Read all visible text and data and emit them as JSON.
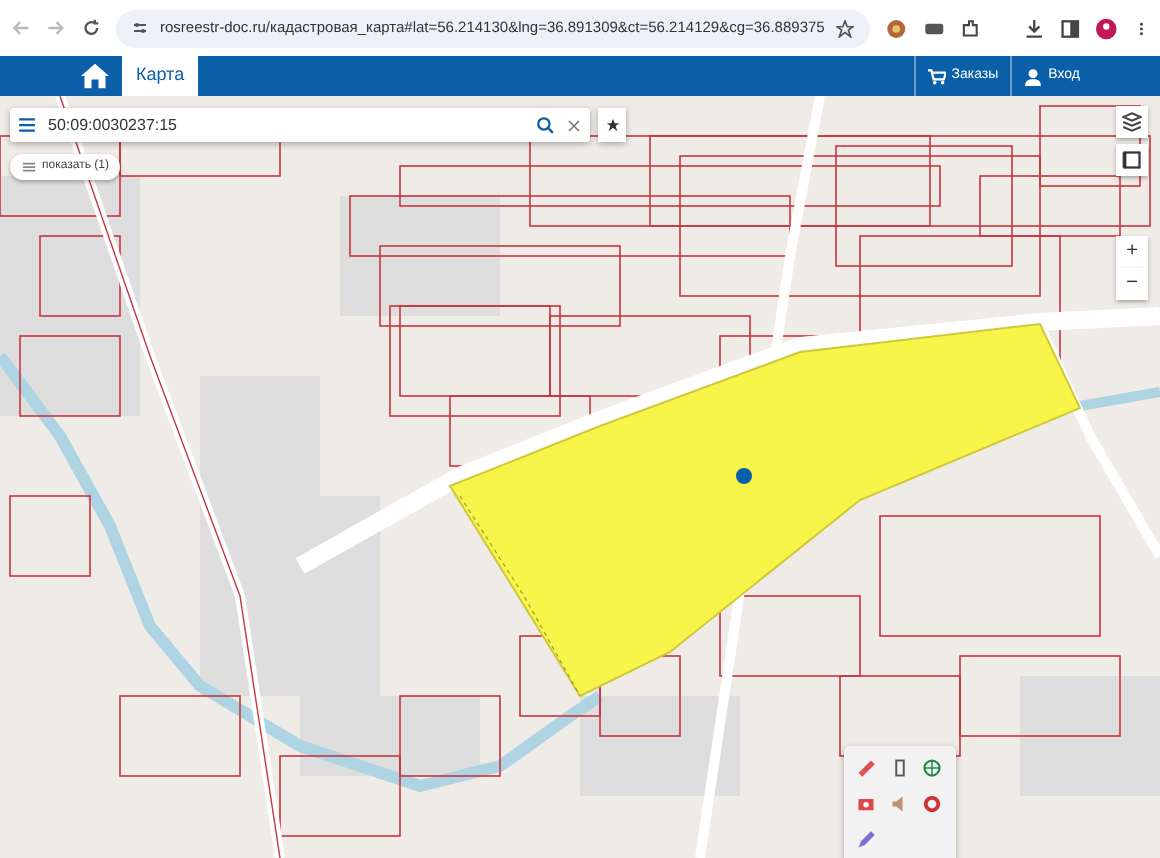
{
  "browser": {
    "url": "rosreestr-doc.ru/кадастровая_карта#lat=56.214130&lng=36.891309&ct=56.214129&cg=36.889375",
    "bookmarked": false
  },
  "navbar": {
    "tabs": [
      {
        "label": "Карта",
        "selected": true
      }
    ],
    "actions": [
      {
        "kind": "cart",
        "label": "Заказы"
      },
      {
        "kind": "user",
        "label": "Вход"
      }
    ]
  },
  "search": {
    "value": "50:09:0030237:15"
  },
  "show_button": {
    "label": "показать (1)"
  },
  "zoom": {
    "in": "+",
    "out": "−"
  }
}
